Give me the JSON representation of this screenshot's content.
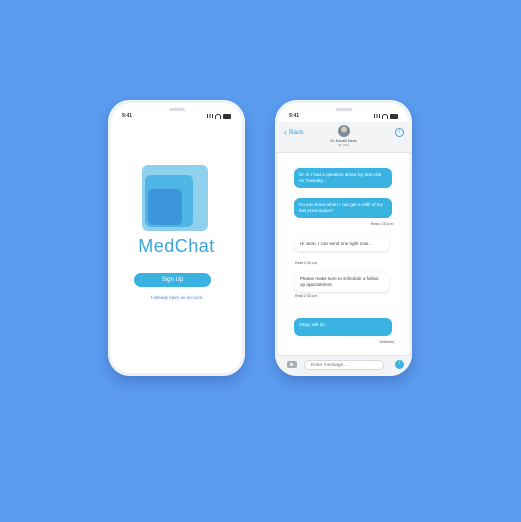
{
  "left_phone": {
    "status_time": "9:41",
    "brand_name": "MedChat",
    "signup_label": "Sign Up",
    "login_link": "I already have an account"
  },
  "right_phone": {
    "status_time": "9:41",
    "header": {
      "back_label": "Back",
      "doctor_name": "Dr. Donald Davis",
      "doctor_status": "Mr. Visit",
      "info_icon": "info-icon"
    },
    "messages": [
      {
        "text": "Dr. D I had a question about my last visit on Tuesday...",
        "direction": "out"
      },
      {
        "text": "Do you know when I can get a refill of my last prescription?",
        "direction": "out"
      },
      {
        "meta": "Read 1:30 p.m."
      },
      {
        "text": "Hi Jane, I can send one right now...",
        "direction": "in"
      },
      {
        "meta": "Read 2:30 p.m."
      },
      {
        "text": "Please make sure to schedule a follow up appointment.",
        "direction": "in"
      },
      {
        "meta": "Read 2:34 p.m."
      },
      {
        "text": "Okay, will do.",
        "direction": "out"
      },
      {
        "meta": "Delivered"
      }
    ],
    "composer": {
      "placeholder": "Enter message...",
      "camera_icon": "camera-icon",
      "send_icon": "send-arrow-icon"
    }
  },
  "colors": {
    "background": "#5b9cf0",
    "accent": "#3ab2e2",
    "brand_text": "#3aa5dc"
  }
}
